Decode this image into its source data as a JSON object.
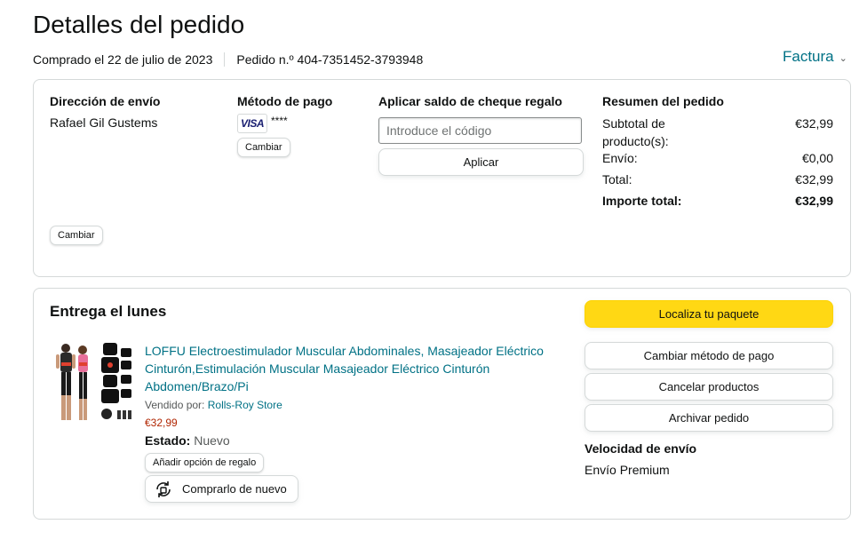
{
  "header": {
    "title": "Detalles del pedido",
    "purchased": "Comprado el 22 de julio de 2023",
    "order_number": "Pedido n.º 404-7351452-3793948",
    "invoice": "Factura"
  },
  "shipping": {
    "heading": "Dirección de envío",
    "name": "Rafael Gil Gustems",
    "change": "Cambiar"
  },
  "payment": {
    "heading": "Método de pago",
    "card_brand": "VISA",
    "card_masked": "****",
    "change": "Cambiar"
  },
  "gift": {
    "heading": "Aplicar saldo de cheque regalo",
    "placeholder": "Introduce el código",
    "apply": "Aplicar"
  },
  "summary": {
    "heading": "Resumen del pedido",
    "subtotal_label": "Subtotal de producto(s):",
    "subtotal": "€32,99",
    "shipping_label": "Envío:",
    "shipping": "€0,00",
    "total_label": "Total:",
    "total": "€32,99",
    "grand_label": "Importe total:",
    "grand": "€32,99"
  },
  "delivery": {
    "heading": "Entrega el lunes",
    "product_title": "LOFFU Electroestimulador Muscular Abdominales, Masajeador Eléctrico Cinturón,Estimulación Muscular Masajeador Eléctrico Cinturón Abdomen/Brazo/Pi",
    "sold_by_label": "Vendido por:",
    "seller": "Rolls-Roy Store",
    "price": "€32,99",
    "condition_label": "Estado:",
    "condition": "Nuevo",
    "gift_option": "Añadir opción de regalo",
    "buy_again": "Comprarlo de nuevo"
  },
  "actions": {
    "track": "Localiza tu paquete",
    "change_payment": "Cambiar método de pago",
    "cancel": "Cancelar productos",
    "archive": "Archivar pedido",
    "speed_heading": "Velocidad de envío",
    "speed": "Envío Premium"
  },
  "colors": {
    "link": "#007185",
    "price": "#b12704",
    "primary_button": "#ffd814"
  }
}
